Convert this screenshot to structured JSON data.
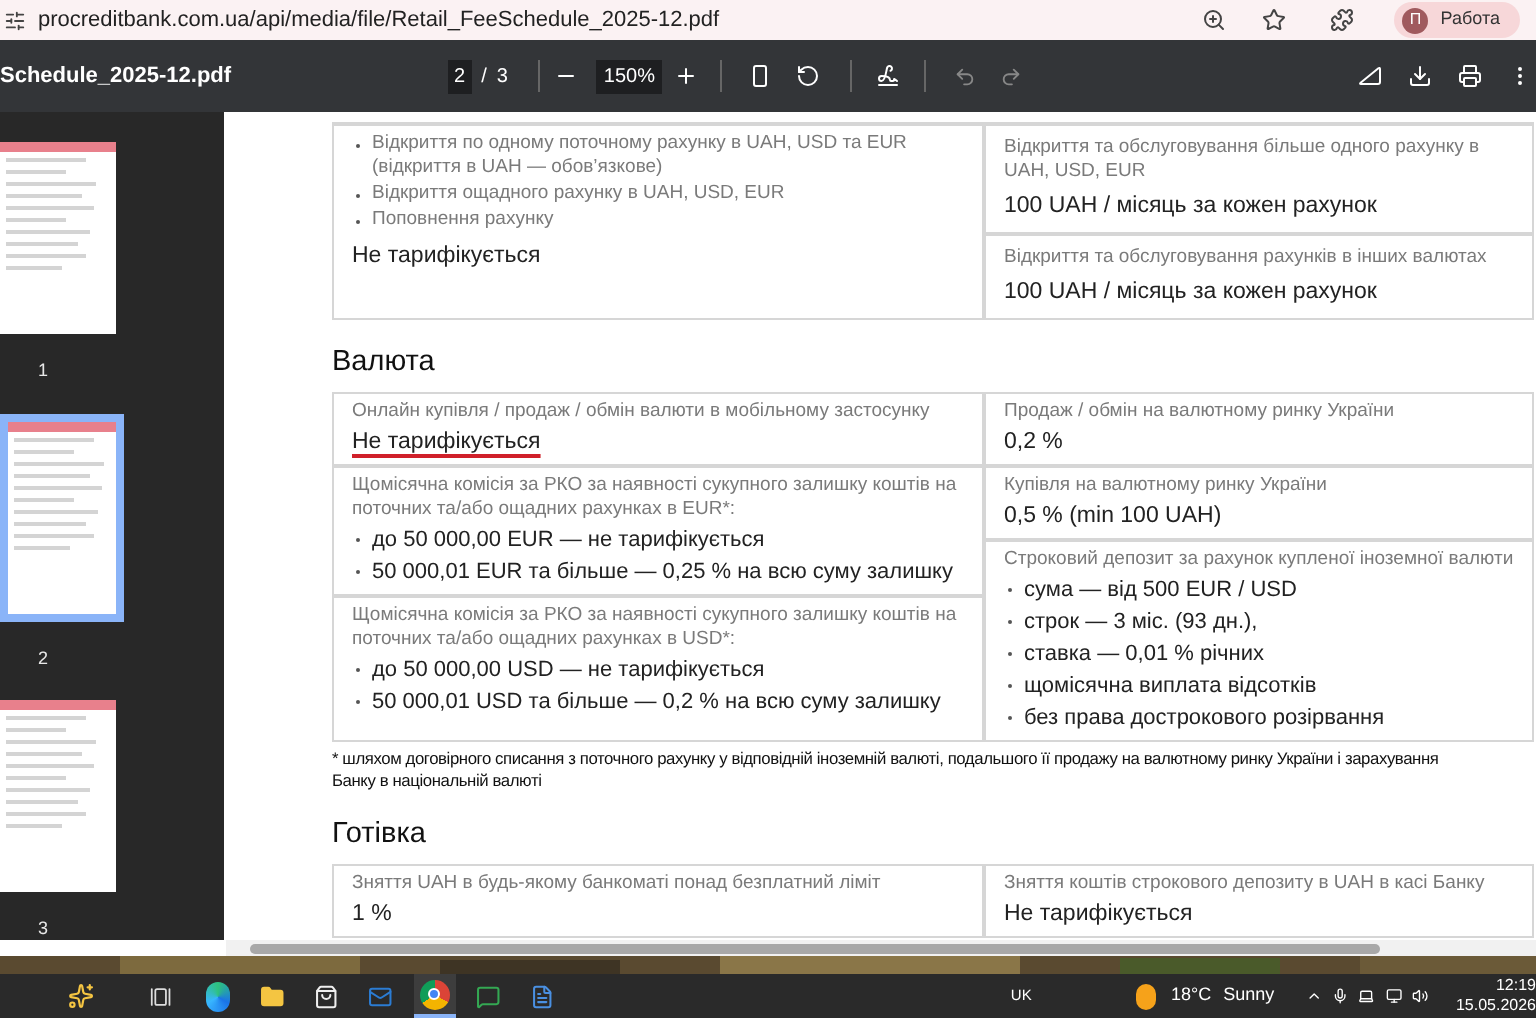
{
  "browser": {
    "url": "procreditbank.com.ua/api/media/file/Retail_FeeSchedule_2025-12.pdf",
    "profile_initial": "П",
    "profile_label": "Работа"
  },
  "pdf_toolbar": {
    "title": "Schedule_2025-12.pdf",
    "page": "2",
    "page_separator": "/",
    "page_total": "3",
    "zoom": "150%"
  },
  "thumbnails": [
    {
      "label": "1",
      "selected": false
    },
    {
      "label": "2",
      "selected": true
    },
    {
      "label": "3",
      "selected": false
    }
  ],
  "top_table": {
    "left": {
      "bullets": [
        "Відкриття по одному поточному рахунку в UAH, USD та EUR (відкриття в UAH — обов’язкове)",
        "Відкриття ощадного рахунку в UAH, USD, EUR",
        "Поповнення рахунку"
      ],
      "value": "Не тарифікується"
    },
    "right": [
      {
        "label": "Відкриття та обслуговування більше одного рахунку в UAH, USD, EUR",
        "value": "100 UAH / місяць за кожен рахунок",
        "underlined": false
      },
      {
        "label": "Відкриття та обслуговування рахунків в інших валютах",
        "value": "100 UAH / місяць за кожен рахунок",
        "underlined": false
      }
    ]
  },
  "sections": [
    {
      "title": "Валюта",
      "left": [
        {
          "label": "Онлайн купівля / продаж / обмін валюти в мобільному застосунку",
          "value": "Не тарифікується",
          "underlined": true
        },
        {
          "label": "Щомісячна комісія за РКО за наявності сукупного залишку коштів на поточних та/або ощадних рахунках в EUR*:",
          "bullets": [
            "до 50 000,00 EUR — не тарифікується",
            "50 000,01 EUR та більше — 0,25 % на всю суму залишку"
          ]
        },
        {
          "label": "Щомісячна комісія за РКО за наявності сукупного залишку коштів на поточних та/або ощадних рахунках в USD*:",
          "bullets": [
            "до 50 000,00 USD — не тарифікується",
            "50 000,01 USD та більше — 0,2 % на всю суму залишку"
          ]
        }
      ],
      "right": [
        {
          "label": "Продаж / обмін на валютному ринку України",
          "value": "0,2 %",
          "underlined": false
        },
        {
          "label": "Купівля на валютному ринку України",
          "value": "0,5 % (min 100 UAH)",
          "underlined": false
        },
        {
          "label": "Строковий депозит за рахунок купленої іноземної валюти",
          "bullets": [
            "сума — від 500 EUR / USD",
            "строк — 3 міс. (93 дн.),",
            "ставка — 0,01 % річних",
            "щомісячна виплата відсотків",
            "без права дострокового розірвання"
          ]
        }
      ],
      "footnote": [
        "* шляхом договірного списання з поточного рахунку у відповідній іноземній валюті, подальшого її продажу на валютному ринку України і зарахування",
        "Банку в національній валюті"
      ]
    },
    {
      "title": "Готівка",
      "left": [
        {
          "label": "Зняття UAH в будь-якому банкоматі понад безплатний ліміт",
          "value": "1 %",
          "underlined": false
        }
      ],
      "right": [
        {
          "label": "Зняття коштів строкового депозиту в UAH в касі Банку",
          "value": "Не тарифікується",
          "underlined": false
        }
      ]
    }
  ],
  "taskbar": {
    "language": "UK",
    "temperature": "18°C",
    "weather": "Sunny",
    "time": "12:19",
    "date": "15.05.2026"
  }
}
